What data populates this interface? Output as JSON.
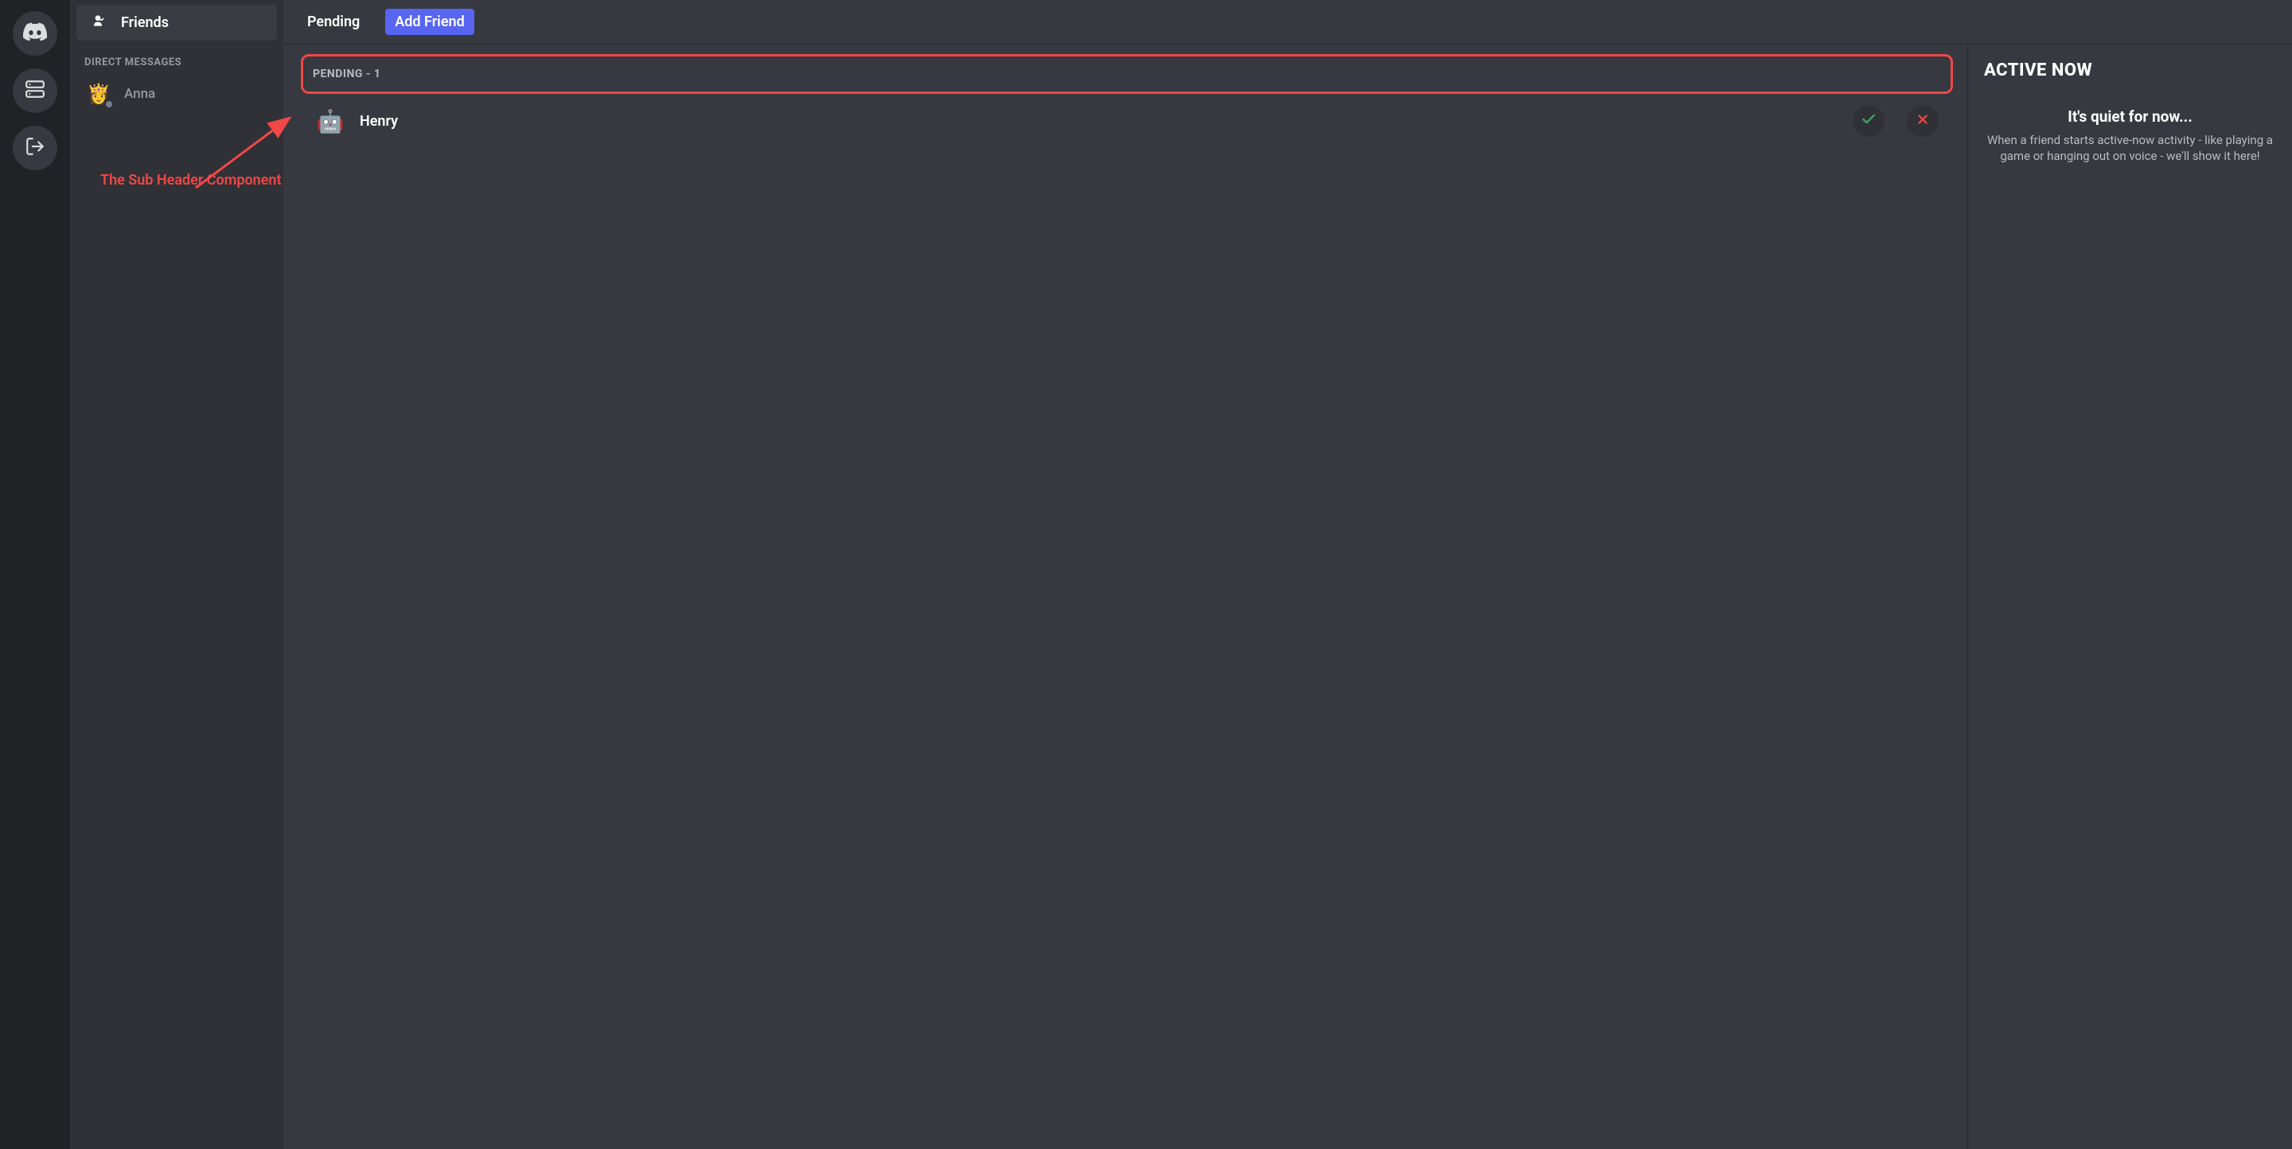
{
  "rail": {
    "icons": [
      "discord-logo",
      "server",
      "logout"
    ]
  },
  "sidebar": {
    "friends_label": "Friends",
    "dm_heading": "DIRECT MESSAGES",
    "dms": [
      {
        "name": "Anna",
        "avatar_emoji": "👸",
        "status": "offline"
      }
    ]
  },
  "topbar": {
    "tab_pending": "Pending",
    "add_friend": "Add Friend"
  },
  "pending": {
    "subheader": "PENDING - 1",
    "items": [
      {
        "name": "Henry",
        "avatar_emoji": "🤖"
      }
    ]
  },
  "active_now": {
    "title": "ACTIVE NOW",
    "quiet_title": "It's quiet for now...",
    "quiet_desc": "When a friend starts active-now activity - like playing a game or hanging out on voice - we'll show it here!"
  },
  "annotation": {
    "label": "The Sub Header Component"
  },
  "colors": {
    "accent": "#5865f2",
    "danger": "#f04747",
    "success": "#3ba55d"
  }
}
